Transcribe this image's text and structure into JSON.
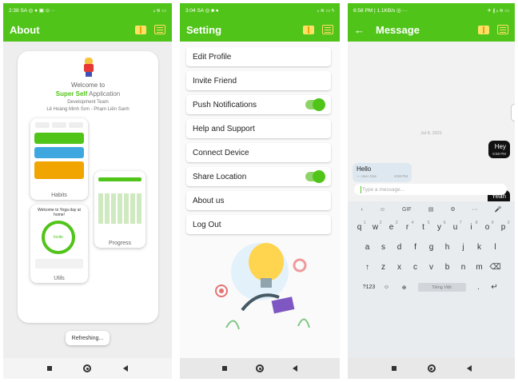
{
  "screens": {
    "about": {
      "status": {
        "time": "2:38 SA",
        "icons": "◎ ● ▣ ⊙ ··",
        "right": "ᵢₗ ≋ ▭"
      },
      "title": "About",
      "welcome": "Welcome to",
      "app_name_prefix": "Super Self",
      "app_name_suffix": " Application",
      "dev_team": "Development Team",
      "dev_names": "Lê Hoàng Minh Sơn - Phạm Liên Sanh",
      "shots": {
        "habits": "Habits",
        "progress": "Progress",
        "utils": "Utils",
        "utils_heading": "Welcome to Yoga day at home!",
        "utils_ring": "Invite"
      },
      "refresh": "Refreshing..."
    },
    "settings": {
      "status": {
        "time": "3:04 SA",
        "icons": "◎ ■ ●",
        "right": "ᵢₗ ≋ ▭ ϟ"
      },
      "title": "Setting",
      "items": [
        {
          "label": "Edit Profile",
          "toggle": false
        },
        {
          "label": "Invite Friend",
          "toggle": false
        },
        {
          "label": "Push Notifications",
          "toggle": true
        },
        {
          "label": "Help and Support",
          "toggle": false
        },
        {
          "label": "Connect Device",
          "toggle": false
        },
        {
          "label": "Share Location",
          "toggle": true
        },
        {
          "label": "About us",
          "toggle": false
        },
        {
          "label": "Log Out",
          "toggle": false
        }
      ]
    },
    "message": {
      "status": {
        "time": "6:58 PM | 1.1KB/s ◎",
        "icons": "···",
        "right": "✈ ∦ ᵢₗ ≋ ▭"
      },
      "title": "Message",
      "date": "Jul 8, 2021",
      "messages": [
        {
          "text": "Hey",
          "time": "6:58 PM",
          "side": "right"
        },
        {
          "text": "Hello",
          "sender": "— User One",
          "time": "6:58 PM",
          "side": "left"
        },
        {
          "text": "Yeah",
          "time": "6:58 PM",
          "side": "right"
        }
      ],
      "input_placeholder": "Type a message...",
      "keyboard": {
        "tools": [
          "‹",
          "☺",
          "GIF",
          "▤",
          "⚙",
          "···",
          "🎤"
        ],
        "row1": [
          "q",
          "w",
          "e",
          "r",
          "t",
          "y",
          "u",
          "i",
          "o",
          "p"
        ],
        "row1_sup": [
          "1",
          "2",
          "3",
          "4",
          "5",
          "6",
          "7",
          "8",
          "9",
          "0"
        ],
        "row2": [
          "a",
          "s",
          "d",
          "f",
          "g",
          "h",
          "j",
          "k",
          "l"
        ],
        "row3": [
          "↑",
          "z",
          "x",
          "c",
          "v",
          "b",
          "n",
          "m",
          "⌫"
        ],
        "row4_left": "?123",
        "row4_mid": "☺",
        "row4_globe": "⊕",
        "space_label": "Tiếng Việt",
        "row4_period": ".",
        "enter": "↵"
      }
    }
  },
  "colors": {
    "brand_green": "#51c41a",
    "icon_yellow": "#ffe066"
  }
}
